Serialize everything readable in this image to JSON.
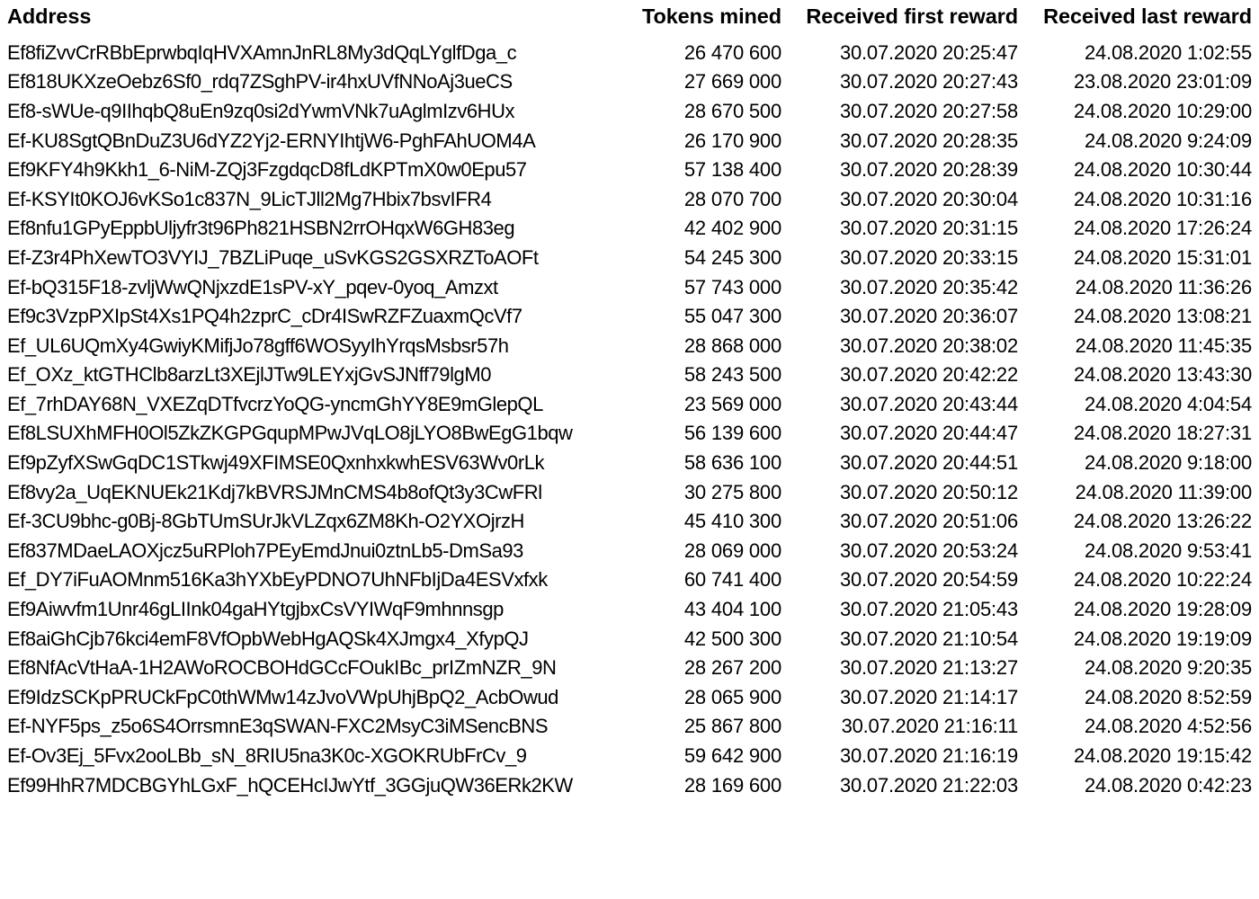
{
  "table": {
    "columns": [
      {
        "key": "address",
        "label": "Address",
        "align": "left"
      },
      {
        "key": "tokens_mined",
        "label": "Tokens mined",
        "align": "right"
      },
      {
        "key": "received_first_reward",
        "label": "Received first reward",
        "align": "right"
      },
      {
        "key": "received_last_reward",
        "label": "Received last reward",
        "align": "right"
      }
    ],
    "rows": [
      {
        "address": "Ef8fiZvvCrRBbEprwbqIqHVXAmnJnRL8My3dQqLYglfDga_c",
        "tokens_mined": "26 470 600",
        "received_first_reward": "30.07.2020 20:25:47",
        "received_last_reward": "24.08.2020 1:02:55"
      },
      {
        "address": "Ef818UKXzeOebz6Sf0_rdq7ZSghPV-ir4hxUVfNNoAj3ueCS",
        "tokens_mined": "27 669 000",
        "received_first_reward": "30.07.2020 20:27:43",
        "received_last_reward": "23.08.2020 23:01:09"
      },
      {
        "address": "Ef8-sWUe-q9IIhqbQ8uEn9zq0si2dYwmVNk7uAglmIzv6HUx",
        "tokens_mined": "28 670 500",
        "received_first_reward": "30.07.2020 20:27:58",
        "received_last_reward": "24.08.2020 10:29:00"
      },
      {
        "address": "Ef-KU8SgtQBnDuZ3U6dYZ2Yj2-ERNYIhtjW6-PghFAhUOM4A",
        "tokens_mined": "26 170 900",
        "received_first_reward": "30.07.2020 20:28:35",
        "received_last_reward": "24.08.2020 9:24:09"
      },
      {
        "address": "Ef9KFY4h9Kkh1_6-NiM-ZQj3FzgdqcD8fLdKPTmX0w0Epu57",
        "tokens_mined": "57 138 400",
        "received_first_reward": "30.07.2020 20:28:39",
        "received_last_reward": "24.08.2020 10:30:44"
      },
      {
        "address": "Ef-KSYIt0KOJ6vKSo1c837N_9LicTJll2Mg7Hbix7bsvIFR4",
        "tokens_mined": "28 070 700",
        "received_first_reward": "30.07.2020 20:30:04",
        "received_last_reward": "24.08.2020 10:31:16"
      },
      {
        "address": "Ef8nfu1GPyEppbUljyfr3t96Ph821HSBN2rrOHqxW6GH83eg",
        "tokens_mined": "42 402 900",
        "received_first_reward": "30.07.2020 20:31:15",
        "received_last_reward": "24.08.2020 17:26:24"
      },
      {
        "address": "Ef-Z3r4PhXewTO3VYIJ_7BZLiPuqe_uSvKGS2GSXRZToAOFt",
        "tokens_mined": "54 245 300",
        "received_first_reward": "30.07.2020 20:33:15",
        "received_last_reward": "24.08.2020 15:31:01"
      },
      {
        "address": "Ef-bQ315F18-zvljWwQNjxzdE1sPV-xY_pqev-0yoq_Amzxt",
        "tokens_mined": "57 743 000",
        "received_first_reward": "30.07.2020 20:35:42",
        "received_last_reward": "24.08.2020 11:36:26"
      },
      {
        "address": "Ef9c3VzpPXIpSt4Xs1PQ4h2zprC_cDr4ISwRZFZuaxmQcVf7",
        "tokens_mined": "55 047 300",
        "received_first_reward": "30.07.2020 20:36:07",
        "received_last_reward": "24.08.2020 13:08:21"
      },
      {
        "address": "Ef_UL6UQmXy4GwiyKMifjJo78gff6WOSyyIhYrqsMsbsr57h",
        "tokens_mined": "28 868 000",
        "received_first_reward": "30.07.2020 20:38:02",
        "received_last_reward": "24.08.2020 11:45:35"
      },
      {
        "address": "Ef_OXz_ktGTHClb8arzLt3XEjlJTw9LEYxjGvSJNff79lgM0",
        "tokens_mined": "58 243 500",
        "received_first_reward": "30.07.2020 20:42:22",
        "received_last_reward": "24.08.2020 13:43:30"
      },
      {
        "address": "Ef_7rhDAY68N_VXEZqDTfvcrzYoQG-yncmGhYY8E9mGlepQL",
        "tokens_mined": "23 569 000",
        "received_first_reward": "30.07.2020 20:43:44",
        "received_last_reward": "24.08.2020 4:04:54"
      },
      {
        "address": "Ef8LSUXhMFH0Ol5ZkZKGPGqupMPwJVqLO8jLYO8BwEgG1bqw",
        "tokens_mined": "56 139 600",
        "received_first_reward": "30.07.2020 20:44:47",
        "received_last_reward": "24.08.2020 18:27:31"
      },
      {
        "address": "Ef9pZyfXSwGqDC1STkwj49XFIMSE0QxnhxkwhESV63Wv0rLk",
        "tokens_mined": "58 636 100",
        "received_first_reward": "30.07.2020 20:44:51",
        "received_last_reward": "24.08.2020 9:18:00"
      },
      {
        "address": "Ef8vy2a_UqEKNUEk21Kdj7kBVRSJMnCMS4b8ofQt3y3CwFRl",
        "tokens_mined": "30 275 800",
        "received_first_reward": "30.07.2020 20:50:12",
        "received_last_reward": "24.08.2020 11:39:00"
      },
      {
        "address": "Ef-3CU9bhc-g0Bj-8GbTUmSUrJkVLZqx6ZM8Kh-O2YXOjrzH",
        "tokens_mined": "45 410 300",
        "received_first_reward": "30.07.2020 20:51:06",
        "received_last_reward": "24.08.2020 13:26:22"
      },
      {
        "address": "Ef837MDaeLAOXjcz5uRPloh7PEyEmdJnui0ztnLb5-DmSa93",
        "tokens_mined": "28 069 000",
        "received_first_reward": "30.07.2020 20:53:24",
        "received_last_reward": "24.08.2020 9:53:41"
      },
      {
        "address": "Ef_DY7iFuAOMnm516Ka3hYXbEyPDNO7UhNFbIjDa4ESVxfxk",
        "tokens_mined": "60 741 400",
        "received_first_reward": "30.07.2020 20:54:59",
        "received_last_reward": "24.08.2020 10:22:24"
      },
      {
        "address": "Ef9Aiwvfm1Unr46gLIInk04gaHYtgjbxCsVYIWqF9mhnnsgp",
        "tokens_mined": "43 404 100",
        "received_first_reward": "30.07.2020 21:05:43",
        "received_last_reward": "24.08.2020 19:28:09"
      },
      {
        "address": "Ef8aiGhCjb76kci4emF8VfOpbWebHgAQSk4XJmgx4_XfypQJ",
        "tokens_mined": "42 500 300",
        "received_first_reward": "30.07.2020 21:10:54",
        "received_last_reward": "24.08.2020 19:19:09"
      },
      {
        "address": "Ef8NfAcVtHaA-1H2AWoROCBOHdGCcFOukIBc_prIZmNZR_9N",
        "tokens_mined": "28 267 200",
        "received_first_reward": "30.07.2020 21:13:27",
        "received_last_reward": "24.08.2020 9:20:35"
      },
      {
        "address": "Ef9IdzSCKpPRUCkFpC0thWMw14zJvoVWpUhjBpQ2_AcbOwud",
        "tokens_mined": "28 065 900",
        "received_first_reward": "30.07.2020 21:14:17",
        "received_last_reward": "24.08.2020 8:52:59"
      },
      {
        "address": "Ef-NYF5ps_z5o6S4OrrsmnE3qSWAN-FXC2MsyC3iMSencBNS",
        "tokens_mined": "25 867 800",
        "received_first_reward": "30.07.2020 21:16:11",
        "received_last_reward": "24.08.2020 4:52:56"
      },
      {
        "address": "Ef-Ov3Ej_5Fvx2ooLBb_sN_8RIU5na3K0c-XGOKRUbFrCv_9",
        "tokens_mined": "59 642 900",
        "received_first_reward": "30.07.2020 21:16:19",
        "received_last_reward": "24.08.2020 19:15:42"
      },
      {
        "address": "Ef99HhR7MDCBGYhLGxF_hQCEHcIJwYtf_3GGjuQW36ERk2KW",
        "tokens_mined": "28 169 600",
        "received_first_reward": "30.07.2020 21:22:03",
        "received_last_reward": "24.08.2020 0:42:23"
      }
    ]
  }
}
